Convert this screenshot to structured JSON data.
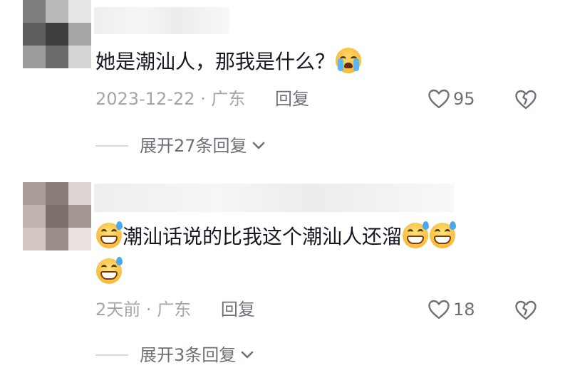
{
  "comments": [
    {
      "text_before": "她是潮汕人，那我是什么？",
      "emoji_after": "crying-face",
      "date": "2023-12-22",
      "separator": "·",
      "location": "广东",
      "reply_label": "回复",
      "likes": "95",
      "expand_label": "展开27条回复"
    },
    {
      "emoji_before": "grinning-sweat-face",
      "text_line1": "潮汕话说的比我这个潮汕人还溜",
      "emojis_after_line1": [
        "grinning-sweat-face",
        "grinning-sweat-face"
      ],
      "emojis_line2": [
        "grinning-sweat-face"
      ],
      "date": "2天前",
      "separator": "·",
      "location": "广东",
      "reply_label": "回复",
      "likes": "18",
      "expand_label": "展开3条回复"
    }
  ],
  "colors": {
    "text": "#161823",
    "meta": "#a3a6ad",
    "secondary": "#6d7079"
  }
}
